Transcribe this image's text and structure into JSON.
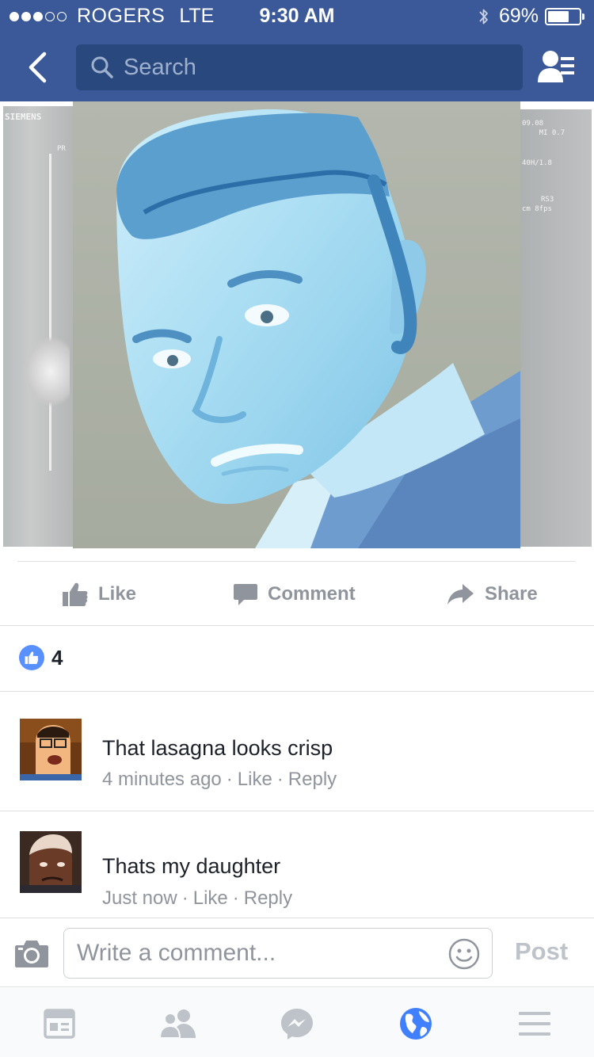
{
  "status_bar": {
    "carrier": "ROGERS",
    "network": "LTE",
    "time": "9:30 AM",
    "battery": "69%",
    "battery_level": 0.69,
    "signal_bars_filled": 3,
    "signal_bars_total": 5
  },
  "nav": {
    "search_placeholder": "Search",
    "back_icon": "chevron-left-icon",
    "friends_icon": "friend-requests-icon"
  },
  "post_actions": {
    "like": "Like",
    "comment": "Comment",
    "share": "Share"
  },
  "likes": {
    "count": "4"
  },
  "comments": [
    {
      "text": "That lasagna looks crisp",
      "time": "4 minutes ago",
      "like": "Like",
      "reply": "Reply"
    },
    {
      "text": "Thats my daughter",
      "time": "Just now",
      "like": "Like",
      "reply": "Reply"
    }
  ],
  "composer": {
    "placeholder": "Write a comment...",
    "post": "Post"
  },
  "tabs": [
    {
      "icon": "news-feed-icon",
      "active": false
    },
    {
      "icon": "friends-icon",
      "active": false
    },
    {
      "icon": "messenger-icon",
      "active": false
    },
    {
      "icon": "globe-icon",
      "active": true
    },
    {
      "icon": "menu-icon",
      "active": false
    }
  ],
  "colors": {
    "brand": "#3b5998",
    "search_bg": "#29487d",
    "muted_text": "#90949c",
    "like_blue": "#5890ff",
    "active_tab": "#4080ff"
  }
}
